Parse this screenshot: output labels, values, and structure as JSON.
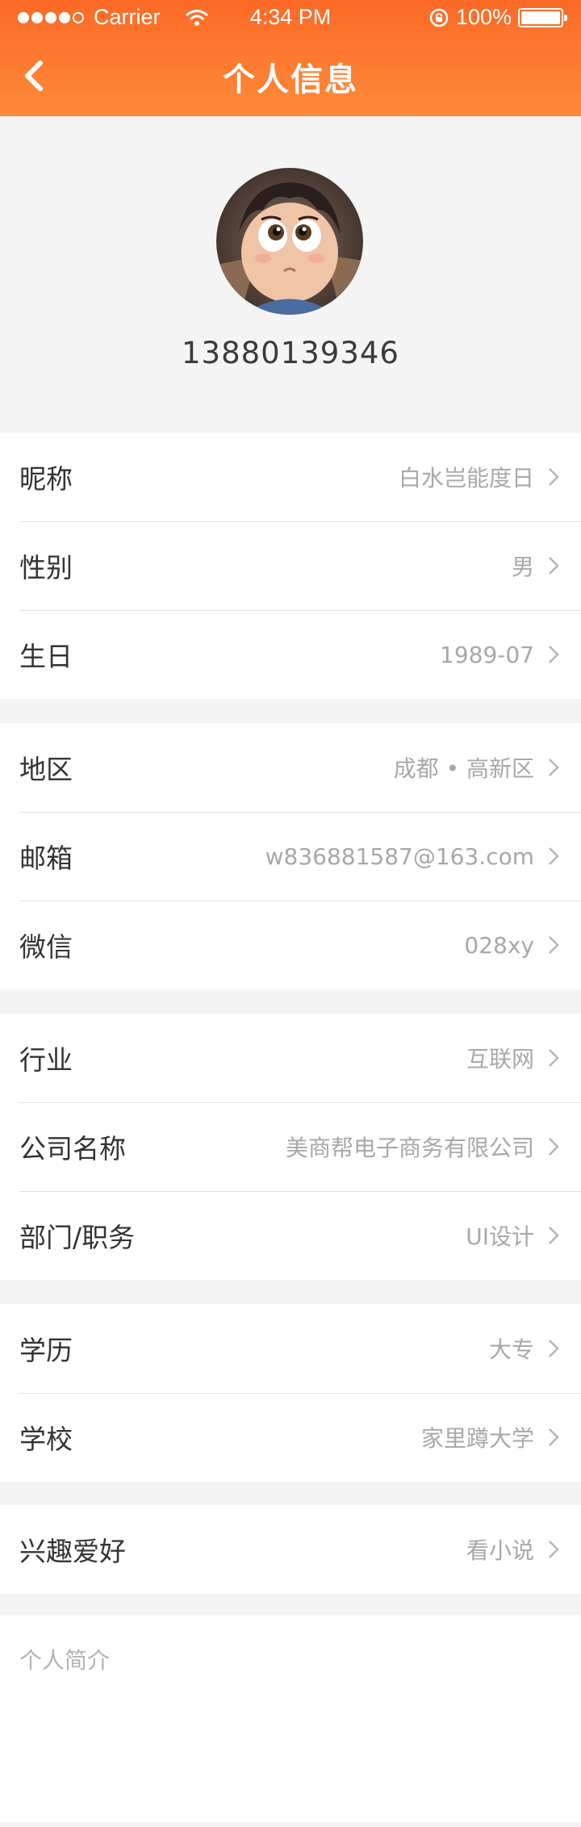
{
  "status_bar": {
    "carrier": "Carrier",
    "time": "4:34 PM",
    "battery": "100%",
    "battery_level": 1.0
  },
  "nav": {
    "title": "个人信息",
    "back_icon": "chevron-left-icon"
  },
  "profile": {
    "phone": "13880139346",
    "avatar_icon": "user-avatar"
  },
  "groups": [
    {
      "rows": [
        {
          "label": "昵称",
          "value": "白水岂能度日"
        },
        {
          "label": "性别",
          "value": "男"
        },
        {
          "label": "生日",
          "value": "1989-07"
        }
      ]
    },
    {
      "rows": [
        {
          "label": "地区",
          "value": "成都 • 高新区"
        },
        {
          "label": "邮箱",
          "value": "w836881587@163.com"
        },
        {
          "label": "微信",
          "value": "028xy"
        }
      ]
    },
    {
      "rows": [
        {
          "label": "行业",
          "value": "互联网"
        },
        {
          "label": "公司名称",
          "value": "美商帮电子商务有限公司"
        },
        {
          "label": "部门/职务",
          "value": "UI设计"
        }
      ]
    },
    {
      "rows": [
        {
          "label": "学历",
          "value": "大专"
        },
        {
          "label": "学校",
          "value": "家里蹲大学"
        }
      ]
    },
    {
      "rows": [
        {
          "label": "兴趣爱好",
          "value": "看小说"
        }
      ]
    }
  ],
  "bio": {
    "placeholder": "个人简介"
  },
  "colors": {
    "accent": "#fb6a26",
    "background": "#f4f4f4",
    "value_text": "#a8a8a8"
  }
}
